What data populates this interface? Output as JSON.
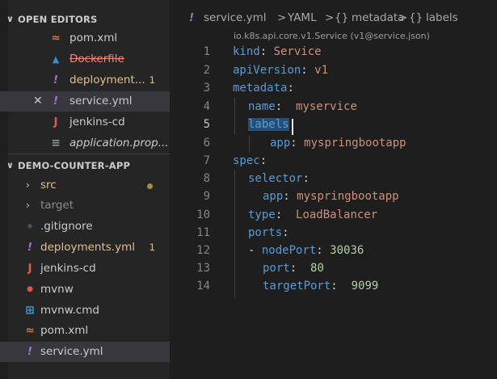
{
  "colors": {
    "accent_yellow": "#e2c08d",
    "deleted_red": "#f48771",
    "key_blue": "#569cd6",
    "string_orange": "#ce9178",
    "number_green": "#b5cea8"
  },
  "open_editors": {
    "title": "OPEN EDITORS",
    "items": [
      {
        "label": "pom.xml",
        "icon": "rss-icon",
        "icon_glyph": "≈"
      },
      {
        "label": "Dockerfile",
        "icon": "docker-icon",
        "icon_glyph": "▲"
      },
      {
        "label": "deployment...",
        "icon": "yaml-icon",
        "icon_glyph": "!",
        "badge": "1"
      },
      {
        "label": "service.yml",
        "icon": "yaml-icon",
        "icon_glyph": "!",
        "close_glyph": "✕"
      },
      {
        "label": "jenkins-cd",
        "icon": "jenkins-icon",
        "icon_glyph": "J"
      },
      {
        "label": "application.prop...",
        "icon": "properties-icon",
        "icon_glyph": "≡"
      }
    ]
  },
  "project": {
    "title": "DEMO-COUNTER-APP",
    "items": [
      {
        "label": "src",
        "type": "folder"
      },
      {
        "label": "target",
        "type": "folder"
      },
      {
        "label": ".gitignore",
        "icon_glyph": "◆"
      },
      {
        "label": "deployments.yml",
        "icon_glyph": "!",
        "badge": "1"
      },
      {
        "label": "jenkins-cd",
        "icon_glyph": "J"
      },
      {
        "label": "mvnw",
        "icon_glyph": "●"
      },
      {
        "label": "mvnw.cmd",
        "icon_glyph": "⊞"
      },
      {
        "label": "pom.xml",
        "icon_glyph": "≈"
      },
      {
        "label": "service.yml",
        "icon_glyph": "!"
      }
    ]
  },
  "breadcrumb": {
    "icon_glyph": "!",
    "file": "service.yml",
    "sep": ">",
    "lang": "YAML",
    "obj_glyph": "{}",
    "seg1": "metadata",
    "seg2": "labels"
  },
  "schema_hint": "io.k8s.api.core.v1.Service (v1@service.json)",
  "code": {
    "line_numbers": [
      "1",
      "2",
      "3",
      "4",
      "5",
      "6",
      "7",
      "8",
      "9",
      "10",
      "11",
      "12",
      "13",
      "14"
    ],
    "l1": {
      "key": "kind",
      "colon": ": ",
      "val": "Service"
    },
    "l2": {
      "key": "apiVersion",
      "colon": ": ",
      "val": "v1"
    },
    "l3": {
      "key": "metadata",
      "colon": ":"
    },
    "l4": {
      "key": "name",
      "colon": ":  ",
      "val": "myservice"
    },
    "l5": {
      "key": "labels",
      "colon": ":"
    },
    "l6": {
      "key": "app",
      "colon": ": ",
      "val": "myspringbootapp"
    },
    "l7": {
      "key": "spec",
      "colon": ":"
    },
    "l8": {
      "key": "selector",
      "colon": ":"
    },
    "l9": {
      "key": "app",
      "colon": ": ",
      "val": "myspringbootapp"
    },
    "l10": {
      "key": "type",
      "colon": ":  ",
      "val": "LoadBalancer"
    },
    "l11": {
      "key": "ports",
      "colon": ":"
    },
    "l12": {
      "dash": "- ",
      "key": "nodePort",
      "colon": ": ",
      "val": "30036"
    },
    "l13": {
      "key": "port",
      "colon": ":  ",
      "val": "80"
    },
    "l14": {
      "key": "targetPort",
      "colon": ":  ",
      "val": "9099"
    }
  }
}
